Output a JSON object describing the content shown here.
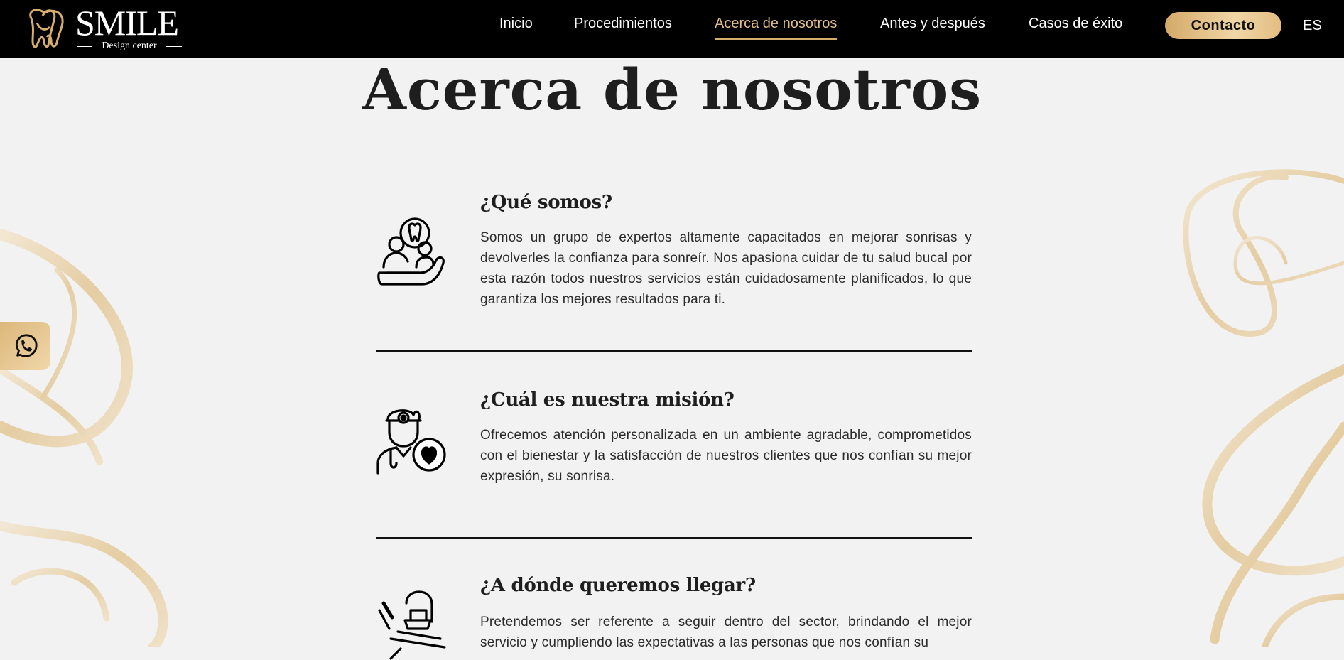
{
  "brand": {
    "name": "SMILE",
    "tagline": "Design center",
    "logo_icon": "tooth-logo-icon"
  },
  "nav": {
    "items": [
      {
        "label": "Inicio",
        "active": false
      },
      {
        "label": "Procedimientos",
        "active": false
      },
      {
        "label": "Acerca de nosotros",
        "active": true
      },
      {
        "label": "Antes y después",
        "active": false
      },
      {
        "label": "Casos de éxito",
        "active": false
      }
    ],
    "contact_label": "Contacto",
    "language": "ES"
  },
  "page": {
    "title": "Acerca de nosotros"
  },
  "sections": [
    {
      "icon": "dental-patient-icon",
      "heading": "¿Qué somos?",
      "text": "Somos un grupo de expertos altamente capacitados en mejorar sonrisas y devolverles la confianza para sonreír. Nos apasiona cuidar de tu salud bucal por esta razón todos nuestros servicios están cuidadosamente planificados, lo que garantiza los mejores resultados para ti."
    },
    {
      "icon": "dentist-heart-icon",
      "heading": "¿Cuál es nuestra misión?",
      "text": "Ofrecemos atención personalizada en un ambiente agradable, comprometidos con el bienestar y la satisfacción de nuestros clientes que nos confían su mejor expresión, su sonrisa."
    },
    {
      "icon": "dental-chair-icon",
      "heading": "¿A dónde queremos llegar?",
      "text": "Pretendemos ser referente a seguir dentro del sector, brindando el mejor servicio y cumpliendo las expectativas a las personas que nos confían su"
    }
  ],
  "floating": {
    "whatsapp_icon": "whatsapp-icon"
  },
  "colors": {
    "header_bg": "#000000",
    "accent_gold": "#d6ad6c",
    "page_bg": "#f2f2f2",
    "text_dark": "#1e1e1e"
  }
}
